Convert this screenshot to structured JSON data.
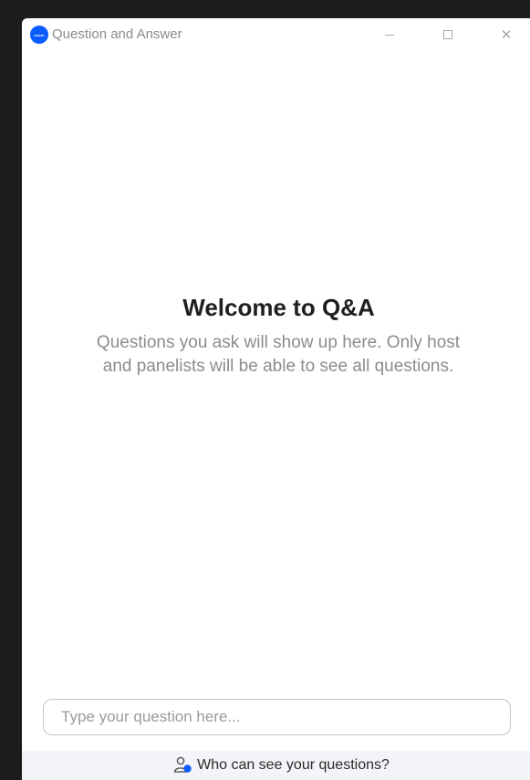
{
  "window": {
    "title": "Question and Answer",
    "logo_text": "zoom",
    "minimize_icon": "minimize-icon",
    "maximize_icon": "maximize-icon",
    "close_icon": "close-icon"
  },
  "welcome": {
    "title": "Welcome to Q&A",
    "subtitle": "Questions you ask will show up here. Only host and panelists will be able to see all questions."
  },
  "question_input": {
    "value": "",
    "placeholder": "Type your question here..."
  },
  "footer": {
    "link_label": "Who can see your questions?",
    "icon": "people-icon"
  },
  "colors": {
    "accent": "#0b5cff",
    "footer_bg": "#f2f4f7"
  }
}
